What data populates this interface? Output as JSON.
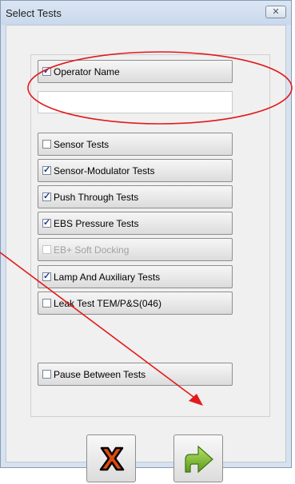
{
  "window": {
    "title": "Select Tests",
    "close_glyph": "✕"
  },
  "operator": {
    "label": "Operator Name",
    "checked": true,
    "value": ""
  },
  "tests": [
    {
      "label": "Sensor Tests",
      "checked": false,
      "enabled": true
    },
    {
      "label": "Sensor-Modulator Tests",
      "checked": true,
      "enabled": true
    },
    {
      "label": "Push Through Tests",
      "checked": true,
      "enabled": true
    },
    {
      "label": "EBS Pressure Tests",
      "checked": true,
      "enabled": true
    },
    {
      "label": "EB+ Soft Docking",
      "checked": false,
      "enabled": false
    },
    {
      "label": "Lamp And Auxiliary Tests",
      "checked": true,
      "enabled": true
    },
    {
      "label": "Leak Test TEM/P&S(046)",
      "checked": false,
      "enabled": true
    }
  ],
  "pause": {
    "label": "Pause Between Tests",
    "checked": false
  },
  "buttons": {
    "cancel_icon": "x-icon",
    "next_icon": "arrow-right-icon"
  },
  "annotations": {
    "highlight_color": "#e3191b"
  }
}
